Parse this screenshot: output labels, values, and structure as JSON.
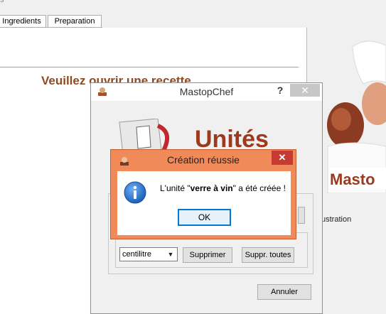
{
  "background": {
    "titlebar_text": "s",
    "tabs": [
      "Ingredients",
      "Preparation"
    ],
    "prompt": "Veuillez ouvrir une recette",
    "illustration_label": "ustration"
  },
  "mastopchef": {
    "title": "MastopChef",
    "help_label": "?",
    "close_label": "✕",
    "unit_value": "centilitre",
    "supprimer_label": "Supprimer",
    "suppr_toutes_label": "Suppr. toutes",
    "annuler_label": "Annuler"
  },
  "dialog": {
    "title": "Création réussie",
    "close_label": "✕",
    "message_prefix": "L'unité \"",
    "message_bold": "verre à vin",
    "message_suffix": "\" a été créée !",
    "ok_label": "OK"
  },
  "art": {
    "units_banner_text": "Unités",
    "chef_logo_text": "Masto",
    "accent": "#8e4a22"
  }
}
